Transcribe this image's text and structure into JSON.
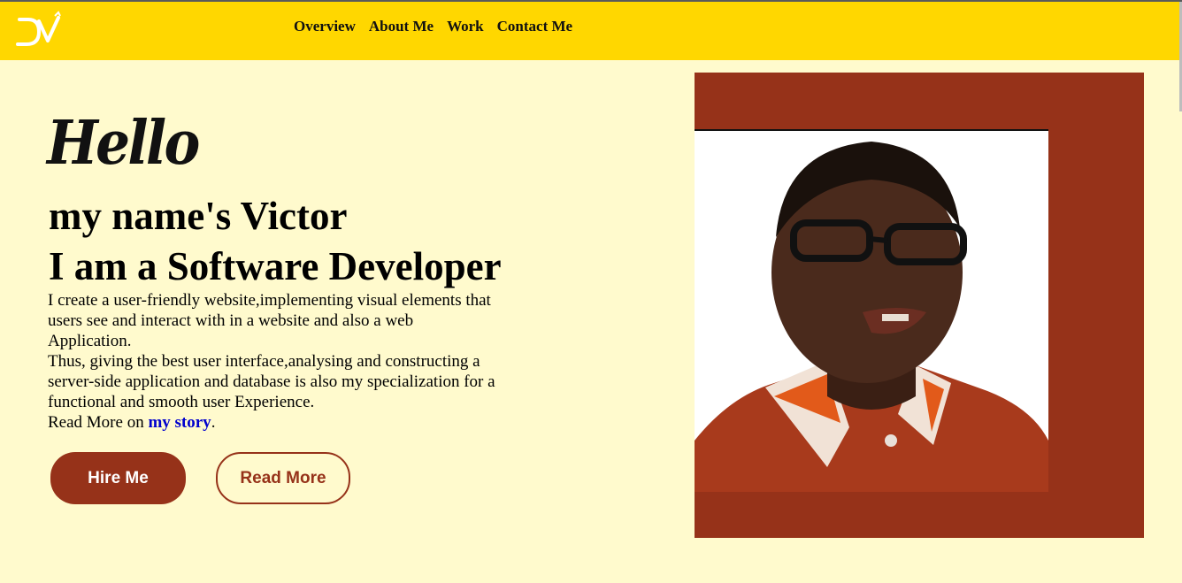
{
  "header": {
    "logo_text": "DV",
    "nav": [
      {
        "label": "Overview"
      },
      {
        "label": "About Me"
      },
      {
        "label": "Work"
      },
      {
        "label": "Contact Me"
      }
    ]
  },
  "hero": {
    "greeting": "Hello",
    "name_line": "my name's Victor",
    "role_line": "I am a Software Developer",
    "description_1": "I create a user-friendly website,implementing visual elements that users see and interact with in a website and also a web Application.",
    "description_2": "Thus, giving the best user interface,analysing and constructing a server-side application and database is also my specialization for a functional and smooth user Experience.",
    "read_more_prefix": "Read More on",
    "story_link": "my story",
    "read_more_suffix": ".",
    "hire_button": "Hire Me",
    "read_more_button": "Read More"
  },
  "colors": {
    "header_bg": "#ffd700",
    "page_bg": "#fffacd",
    "accent": "#963219",
    "link": "#0000cd"
  },
  "icons": {
    "logo": "dv-monogram-logo"
  }
}
